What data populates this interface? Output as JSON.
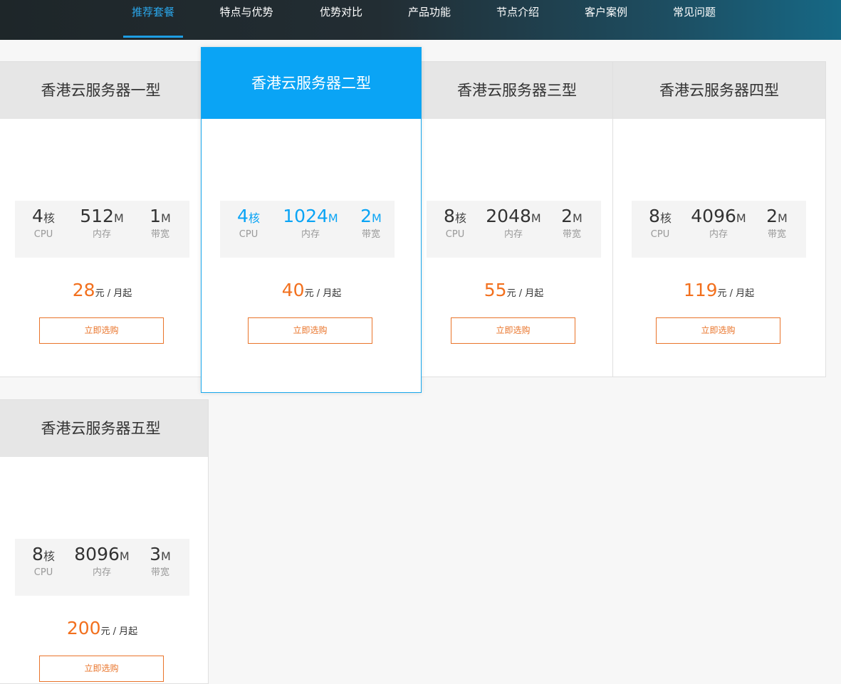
{
  "nav": {
    "items": [
      "推荐套餐",
      "特点与优势",
      "优势对比",
      "产品功能",
      "节点介绍",
      "客户案例",
      "常见问题"
    ]
  },
  "colors": {
    "accent": "#0aa4f5",
    "price": "#f2701e",
    "button_border": "#e9742a",
    "nav_bg": "#222d33"
  },
  "plans": [
    {
      "name": "香港云服务器一型",
      "cpu": "4",
      "cpu_unit": "核",
      "cpu_label": "CPU",
      "mem": "512",
      "mem_unit": "M",
      "mem_label": "内存",
      "bw": "1",
      "bw_unit": "M",
      "bw_label": "带宽",
      "price": "28",
      "price_suffix": "元 / 月起",
      "button": "立即选购"
    },
    {
      "name": "香港云服务器二型",
      "cpu": "4",
      "cpu_unit": "核",
      "cpu_label": "CPU",
      "mem": "1024",
      "mem_unit": "M",
      "mem_label": "内存",
      "bw": "2",
      "bw_unit": "M",
      "bw_label": "带宽",
      "price": "40",
      "price_suffix": "元 / 月起",
      "button": "立即选购"
    },
    {
      "name": "香港云服务器三型",
      "cpu": "8",
      "cpu_unit": "核",
      "cpu_label": "CPU",
      "mem": "2048",
      "mem_unit": "M",
      "mem_label": "内存",
      "bw": "2",
      "bw_unit": "M",
      "bw_label": "带宽",
      "price": "55",
      "price_suffix": "元 / 月起",
      "button": "立即选购"
    },
    {
      "name": "香港云服务器四型",
      "cpu": "8",
      "cpu_unit": "核",
      "cpu_label": "CPU",
      "mem": "4096",
      "mem_unit": "M",
      "mem_label": "内存",
      "bw": "2",
      "bw_unit": "M",
      "bw_label": "带宽",
      "price": "119",
      "price_suffix": "元 / 月起",
      "button": "立即选购"
    },
    {
      "name": "香港云服务器五型",
      "cpu": "8",
      "cpu_unit": "核",
      "cpu_label": "CPU",
      "mem": "8096",
      "mem_unit": "M",
      "mem_label": "内存",
      "bw": "3",
      "bw_unit": "M",
      "bw_label": "带宽",
      "price": "200",
      "price_suffix": "元 / 月起",
      "button": "立即选购"
    }
  ]
}
